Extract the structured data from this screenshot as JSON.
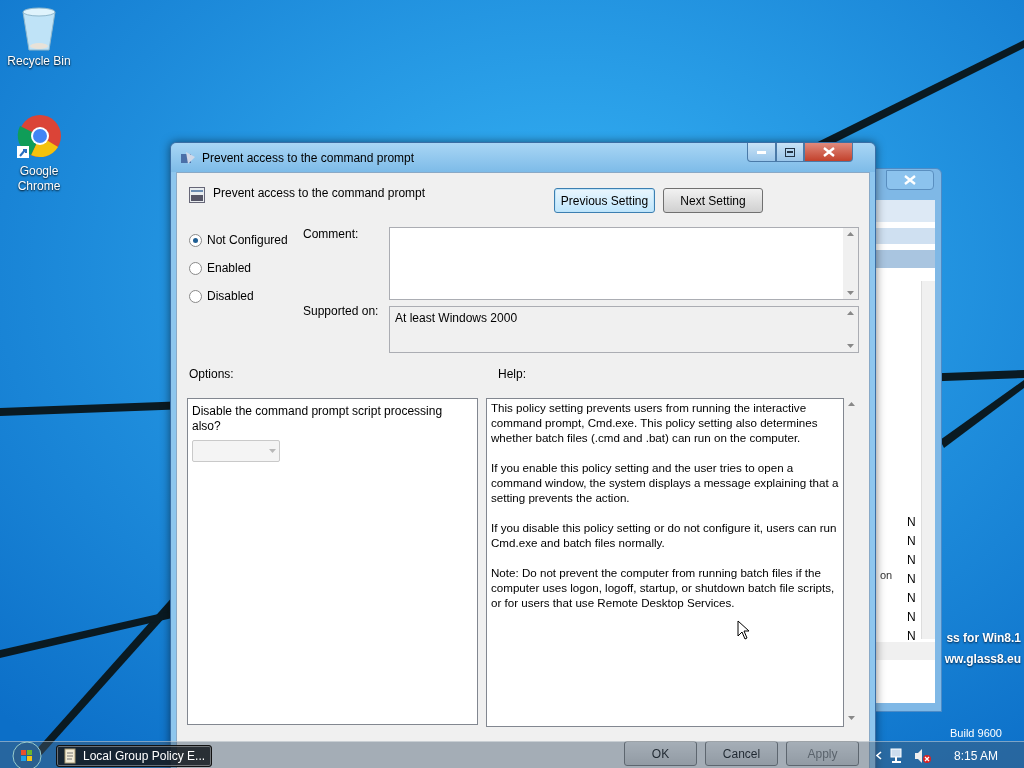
{
  "desktop": {
    "icons": [
      {
        "kind": "recycle",
        "label": "Recycle Bin"
      },
      {
        "kind": "chrome",
        "label": "Google Chrome"
      }
    ],
    "watermark": [
      "ss for Win8.1",
      "ww.glass8.eu"
    ],
    "build": "Build 9600"
  },
  "background_window": {
    "side_text": "on",
    "column_cells": [
      "N",
      "N",
      "N",
      "N",
      "N",
      "N",
      "N"
    ]
  },
  "dialog": {
    "title": "Prevent access to the command prompt",
    "heading": "Prevent access to the command prompt",
    "nav_buttons": [
      {
        "label": "Previous Setting",
        "focused": true
      },
      {
        "label": "Next Setting",
        "focused": false
      }
    ],
    "radios": [
      {
        "label": "Not Configured",
        "selected": true
      },
      {
        "label": "Enabled",
        "selected": false
      },
      {
        "label": "Disabled",
        "selected": false
      }
    ],
    "comment": {
      "label": "Comment:"
    },
    "supported_on": {
      "label": "Supported on:",
      "value": "At least Windows 2000"
    },
    "options": {
      "label": "Options:",
      "prompt": "Disable the command prompt script processing also?",
      "dropdown": {
        "disabled": true
      }
    },
    "help": {
      "label": "Help:",
      "paragraphs": [
        "This policy setting prevents users from running the interactive command prompt, Cmd.exe.  This policy setting also determines whether batch files (.cmd and .bat) can run on the computer.",
        "If you enable this policy setting and the user tries to open a command window, the system displays a message explaining that a setting prevents the action.",
        "If you disable this policy setting or do not configure it, users can run Cmd.exe and batch files normally.",
        "Note: Do not prevent the computer from running batch files if the computer uses logon, logoff, startup, or shutdown batch file scripts, or for users that use Remote Desktop Services."
      ]
    },
    "footer_buttons": [
      {
        "label": "OK",
        "disabled": false
      },
      {
        "label": "Cancel",
        "disabled": false
      },
      {
        "label": "Apply",
        "disabled": true
      }
    ]
  },
  "taskbar": {
    "task": {
      "label": "Local Group Policy E..."
    },
    "clock": "8:15 AM"
  }
}
